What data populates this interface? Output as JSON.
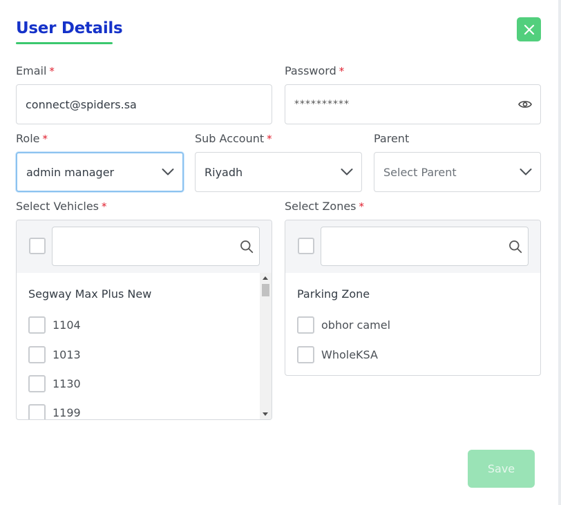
{
  "dialog": {
    "title": "User Details",
    "accent_color": "#1532c9",
    "close_icon": "close-icon"
  },
  "fields": {
    "email": {
      "label": "Email",
      "required_mark": "*",
      "value": "connect@spiders.sa"
    },
    "password": {
      "label": "Password",
      "required_mark": "*",
      "value": "**********",
      "toggle_icon": "eye-icon"
    },
    "role": {
      "label": "Role",
      "required_mark": "*",
      "value": "admin manager"
    },
    "sub_account": {
      "label": "Sub Account",
      "required_mark": "*",
      "value": "Riyadh"
    },
    "parent": {
      "label": "Parent",
      "placeholder": "Select Parent"
    }
  },
  "vehicles": {
    "label": "Select Vehicles",
    "required_mark": "*",
    "search_value": "",
    "group": "Segway Max Plus New",
    "items": [
      {
        "label": "1104",
        "checked": false
      },
      {
        "label": "1013",
        "checked": false
      },
      {
        "label": "1130",
        "checked": false
      },
      {
        "label": "1199",
        "checked": false
      }
    ]
  },
  "zones": {
    "label": "Select Zones",
    "required_mark": "*",
    "search_value": "",
    "group": "Parking Zone",
    "items": [
      {
        "label": "obhor camel",
        "checked": false
      },
      {
        "label": "WholeKSA",
        "checked": false
      }
    ]
  },
  "actions": {
    "save_label": "Save",
    "save_color": "#9ae3b6"
  }
}
